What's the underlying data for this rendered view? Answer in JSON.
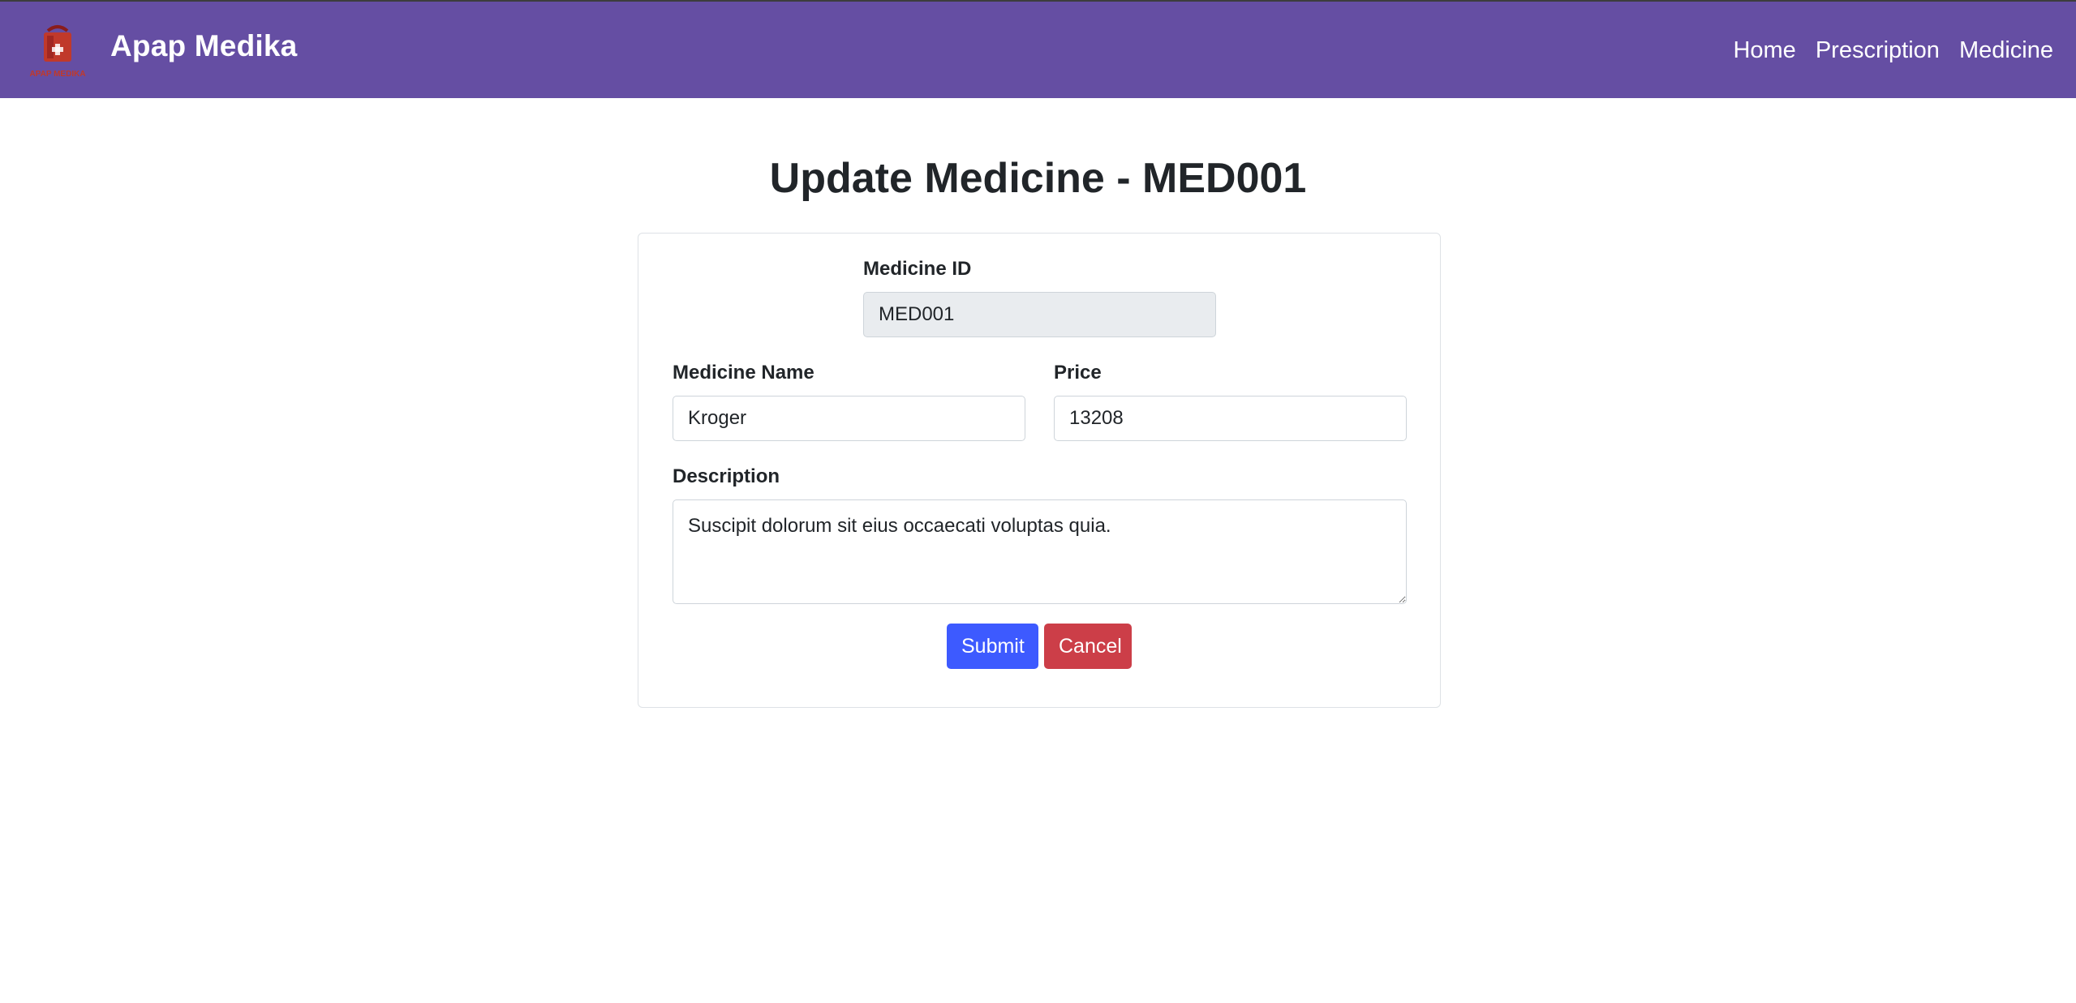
{
  "header": {
    "brand_name": "Apap Medika",
    "logo_text": "APAP MEDIKA",
    "nav": [
      "Home",
      "Prescription",
      "Medicine"
    ]
  },
  "page": {
    "title": "Update Medicine - MED001"
  },
  "form": {
    "medicine_id_label": "Medicine ID",
    "medicine_id_value": "MED001",
    "name_label": "Medicine Name",
    "name_value": "Kroger",
    "price_label": "Price",
    "price_value": "13208",
    "description_label": "Description",
    "description_value": "Suscipit dolorum sit eius occaecati voluptas quia.",
    "submit_label": "Submit",
    "cancel_label": "Cancel"
  },
  "colors": {
    "navbar": "#654ea3",
    "submit": "#3d5aff",
    "cancel": "#cc3e48",
    "logo_red": "#c0392b"
  }
}
